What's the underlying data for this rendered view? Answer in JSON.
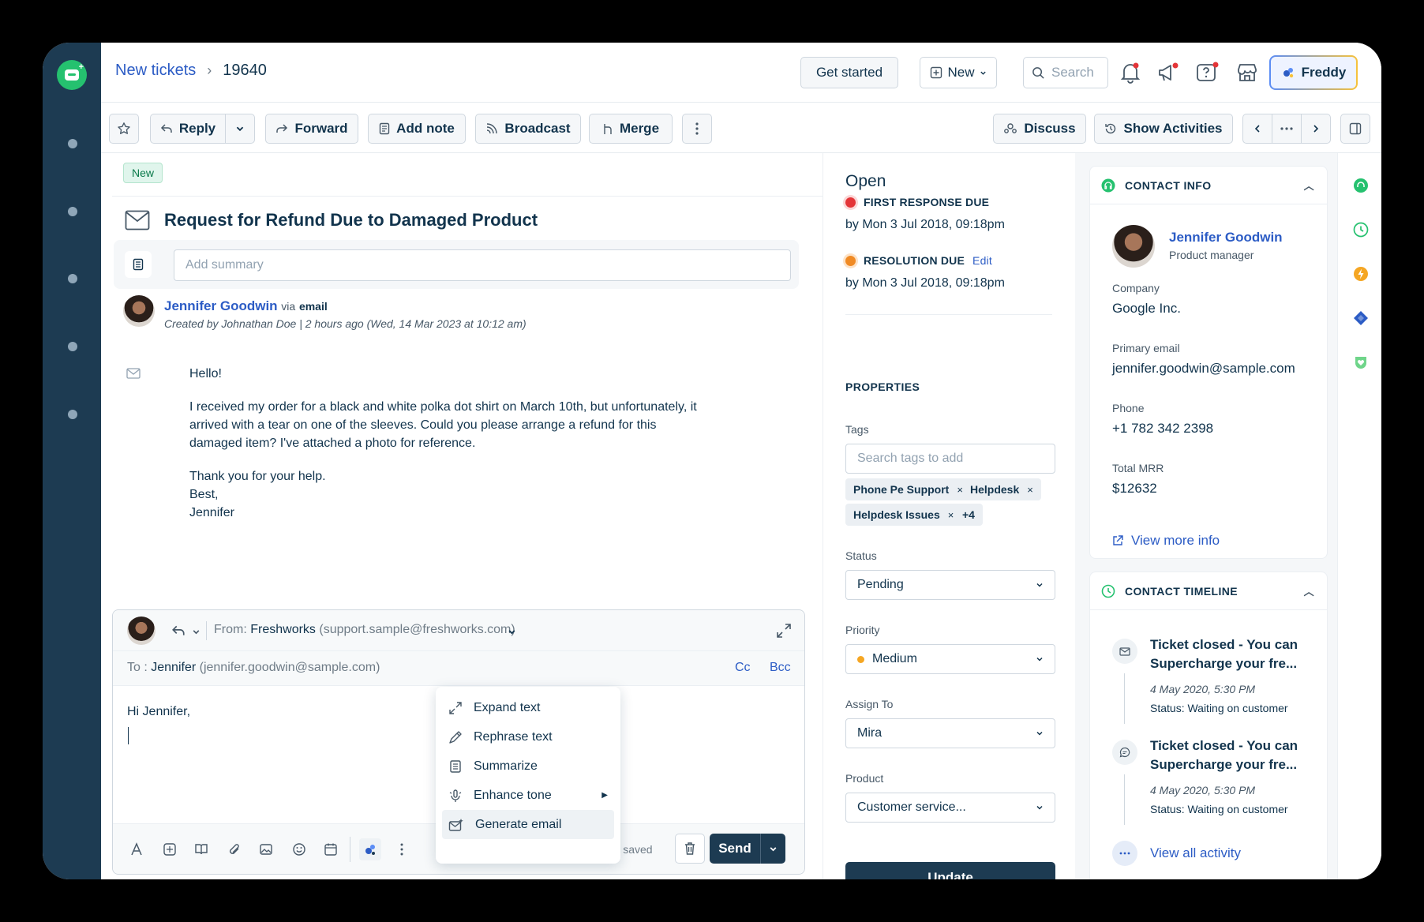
{
  "breadcrumb": {
    "parent": "New tickets",
    "separator": "›",
    "current": "19640"
  },
  "header": {
    "get_started": "Get started",
    "new_label": "New",
    "search_placeholder": "Search",
    "freddy": "Freddy"
  },
  "toolbar": {
    "reply": "Reply",
    "forward": "Forward",
    "add_note": "Add note",
    "broadcast": "Broadcast",
    "merge": "Merge",
    "discuss": "Discuss",
    "show_activities": "Show Activities"
  },
  "ticket": {
    "badge": "New",
    "title": "Request for Refund Due to Damaged Product",
    "summary_placeholder": "Add summary",
    "sender_name": "Jennifer Goodwin",
    "via": "via",
    "channel": "email",
    "created": "Created by Johnathan Doe  |  2 hours ago (Wed, 14 Mar 2023 at 10:12 am)",
    "body": [
      "Hello!",
      "I received my order for a black and white polka dot shirt on March 10th, but unfortunately, it arrived with a tear on one of the sleeves. Could you please arrange a refund for this damaged item? I've attached a photo for reference.",
      "Thank you for your help.",
      "Best,",
      "Jennifer"
    ]
  },
  "reply": {
    "from_label": "From:",
    "from_name": "Freshworks",
    "from_email": "(support.sample@freshworks.com)",
    "to_label": "To :",
    "to_name": "Jennifer",
    "to_email": "(jennifer.goodwin@sample.com)",
    "cc": "Cc",
    "bcc": "Bcc",
    "greeting": "Hi Jennifer,",
    "draft": "Draft saved",
    "send": "Send"
  },
  "ai_menu": {
    "items": [
      "Expand text",
      "Rephrase text",
      "Summarize",
      "Enhance tone",
      "Generate email"
    ],
    "active_index": 4
  },
  "properties": {
    "status_title": "Open",
    "first_response_label": "FIRST RESPONSE DUE",
    "first_response_date": "by Mon 3 Jul 2018, 09:18pm",
    "resolution_label": "RESOLUTION DUE",
    "resolution_edit": "Edit",
    "resolution_date": "by Mon 3 Jul 2018, 09:18pm",
    "section": "PROPERTIES",
    "tags_label": "Tags",
    "tags_placeholder": "Search tags to add",
    "tags": [
      "Phone Pe Support",
      "Helpdesk",
      "Helpdesk Issues"
    ],
    "tags_more": "+4",
    "status_label": "Status",
    "status_value": "Pending",
    "priority_label": "Priority",
    "priority_value": "Medium",
    "assign_label": "Assign To",
    "assign_value": "Mira",
    "product_label": "Product",
    "product_value": "Customer service...",
    "update": "Update",
    "colors": {
      "first_response_dot": "#e43538",
      "resolution_dot": "#f08a24",
      "priority_dot": "#f5a623"
    }
  },
  "contact": {
    "header": "CONTACT INFO",
    "name": "Jennifer Goodwin",
    "role": "Product manager",
    "company_label": "Company",
    "company": "Google Inc.",
    "email_label": "Primary email",
    "email": "jennifer.goodwin@sample.com",
    "phone_label": "Phone",
    "phone": "+1 782 342 2398",
    "mrr_label": "Total MRR",
    "mrr": "$12632",
    "view_more": "View more info"
  },
  "timeline": {
    "header": "CONTACT TIMELINE",
    "items": [
      {
        "title": "Ticket closed - You can Supercharge your fre...",
        "date": "4 May 2020, 5:30 PM",
        "status": "Status: Waiting on customer"
      },
      {
        "title": "Ticket closed - You can Supercharge your fre...",
        "date": "4 May 2020, 5:30 PM",
        "status": "Status: Waiting on customer"
      }
    ],
    "view_all": "View all activity"
  }
}
